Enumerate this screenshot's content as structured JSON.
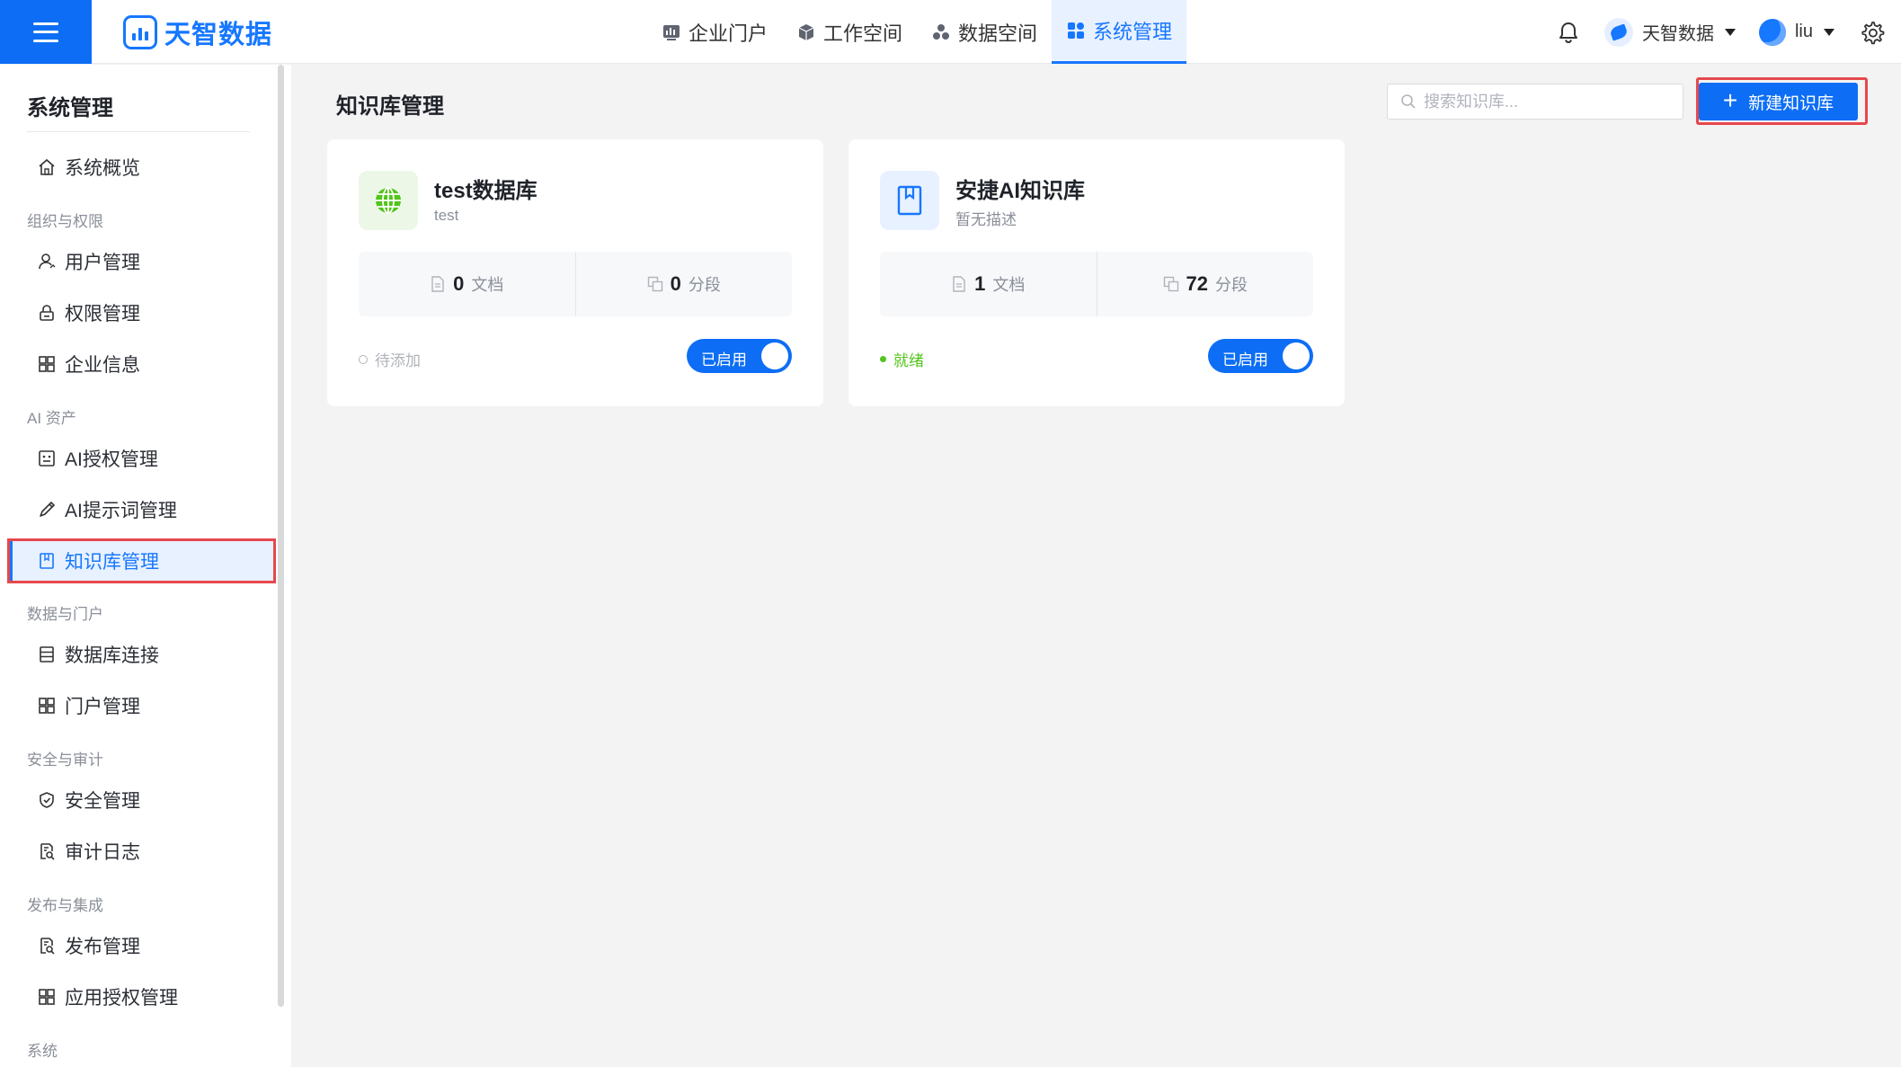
{
  "brand": {
    "name": "天智数据"
  },
  "topnav": [
    {
      "label": "企业门户",
      "icon": "dashboard-icon",
      "active": false
    },
    {
      "label": "工作空间",
      "icon": "cube-icon",
      "active": false
    },
    {
      "label": "数据空间",
      "icon": "cluster-icon",
      "active": false
    },
    {
      "label": "系统管理",
      "icon": "grid-icon",
      "active": true
    }
  ],
  "header": {
    "org_name": "天智数据",
    "user_name": "liu"
  },
  "sidebar": {
    "title": "系统管理",
    "overview": "系统概览",
    "groups": {
      "org": "组织与权限",
      "ai": "AI 资产",
      "data": "数据与门户",
      "security": "安全与审计",
      "publish": "发布与集成",
      "system": "系统"
    },
    "items": {
      "users": "用户管理",
      "permissions": "权限管理",
      "company": "企业信息",
      "ai_auth": "AI授权管理",
      "ai_prompt": "AI提示词管理",
      "knowledge": "知识库管理",
      "db_conn": "数据库连接",
      "portal": "门户管理",
      "security": "安全管理",
      "audit": "审计日志",
      "release": "发布管理",
      "app_auth": "应用授权管理"
    }
  },
  "main": {
    "title": "知识库管理",
    "search_placeholder": "搜索知识库...",
    "create_label": "新建知识库",
    "cards": [
      {
        "name": "test数据库",
        "description": "test",
        "icon": "globe-icon",
        "doc_count": "0",
        "doc_label": "文档",
        "segment_count": "0",
        "segment_label": "分段",
        "status": "待添加",
        "status_color": "#b0b4bb",
        "toggle_label": "已启用"
      },
      {
        "name": "安捷AI知识库",
        "description": "暂无描述",
        "icon": "book-icon",
        "doc_count": "1",
        "doc_label": "文档",
        "segment_count": "72",
        "segment_label": "分段",
        "status": "就绪",
        "status_color": "#52c41a",
        "toggle_label": "已启用"
      }
    ]
  },
  "colors": {
    "accent": "#0d6ef5",
    "highlight_border": "#e5484d",
    "ready": "#52c41a"
  }
}
